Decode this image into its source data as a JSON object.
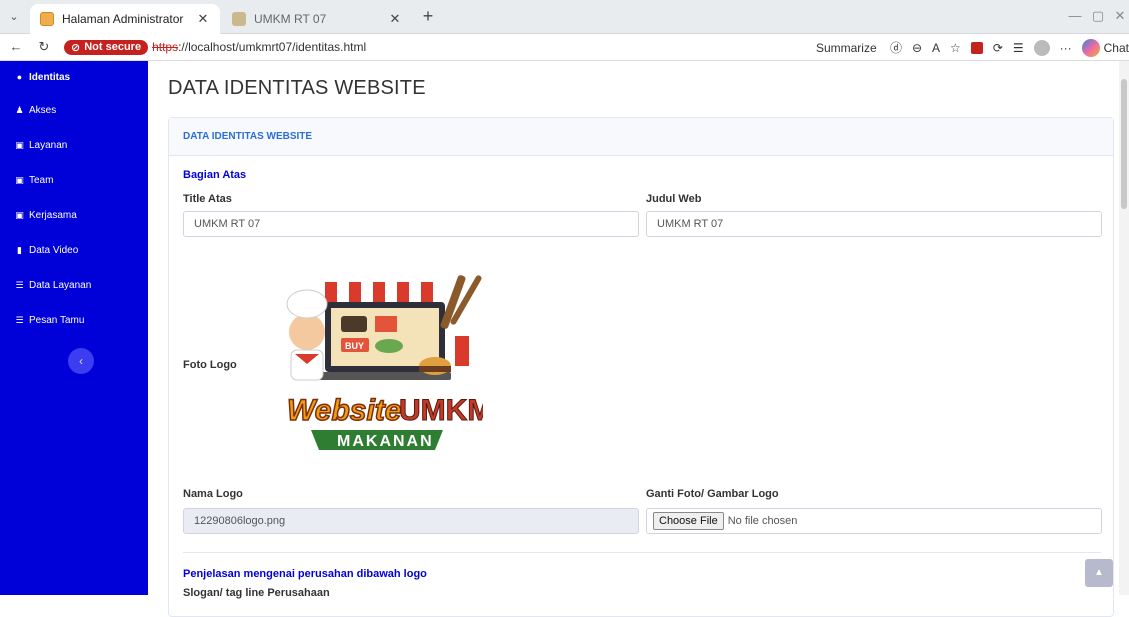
{
  "browser": {
    "tabs": [
      {
        "title": "Halaman Administrator",
        "close": "✕"
      },
      {
        "title": "UMKM RT 07",
        "close": "✕"
      }
    ],
    "new_tab": "+",
    "not_secure": "Not secure",
    "url_scheme": "https",
    "url_rest": "://localhost/umkmrt07/identitas.html",
    "summarize": "Summarize",
    "chat": "Chat"
  },
  "sidebar": {
    "items": [
      {
        "label": "Identitas",
        "icon": "user-circle-icon"
      },
      {
        "label": "Akses",
        "icon": "users-icon"
      },
      {
        "label": "Layanan",
        "icon": "image-icon"
      },
      {
        "label": "Team",
        "icon": "image-icon"
      },
      {
        "label": "Kerjasama",
        "icon": "image-icon"
      },
      {
        "label": "Data Video",
        "icon": "file-icon"
      },
      {
        "label": "Data Layanan",
        "icon": "list-icon"
      },
      {
        "label": "Pesan Tamu",
        "icon": "list-icon"
      }
    ],
    "collapse": "‹"
  },
  "main": {
    "heading": "DATA IDENTITAS WEBSITE",
    "card_title": "DATA IDENTITAS WEBSITE",
    "section_top": "Bagian Atas",
    "title_atas_label": "Title Atas",
    "title_atas_value": "UMKM RT 07",
    "judul_web_label": "Judul Web",
    "judul_web_value": "UMKM RT 07",
    "foto_logo_label": "Foto Logo",
    "logo_text_1": "Website",
    "logo_text_2": "UMKM",
    "logo_text_3": "MAKANAN",
    "logo_buy": "BUY",
    "nama_logo_label": "Nama Logo",
    "nama_logo_value": "12290806logo.png",
    "ganti_label": "Ganti Foto/ Gambar Logo",
    "choose_file": "Choose File",
    "no_file": "No file chosen",
    "section_bottom": "Penjelasan mengenai perusahan dibawah logo",
    "slogan_label": "Slogan/ tag line Perusahaan"
  },
  "colors": {
    "sidebar": "#0000d9",
    "accent": "#2a6fd6"
  }
}
